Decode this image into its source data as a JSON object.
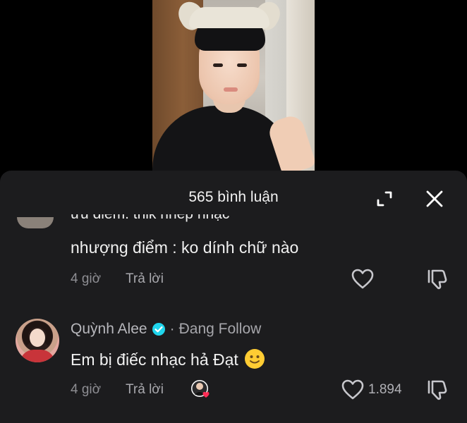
{
  "header": {
    "comment_count_title": "565 bình luận",
    "expand_icon": "expand-icon",
    "close_icon": "close-icon"
  },
  "comments": [
    {
      "text_line_1_partial": "ưu điểm: thik nhép nhạc",
      "text_line_2": "nhượng điểm : ko dính chữ nào",
      "time": "4 giờ",
      "reply_label": "Trả lời",
      "like_icon": "heart-outline-icon",
      "dislike_icon": "thumbs-down-icon"
    },
    {
      "author": "Quỳnh Alee",
      "verified_icon": "verified-badge-icon",
      "separator": "·",
      "follow_status": "Đang Follow",
      "text": "Em bị điếc nhạc hả Đạt",
      "emoji": "slightly-smiling-face",
      "time": "4 giờ",
      "reply_label": "Trả lời",
      "creator_liked_icon": "creator-liked-icon",
      "like_icon": "heart-outline-icon",
      "likes": "1.894",
      "dislike_icon": "thumbs-down-icon"
    }
  ],
  "colors": {
    "background": "#000000",
    "sheet": "#1c1c1e",
    "secondary_text": "#8e8e93",
    "verified": "#20d5ec",
    "heart_badge": "#fe2c55"
  }
}
